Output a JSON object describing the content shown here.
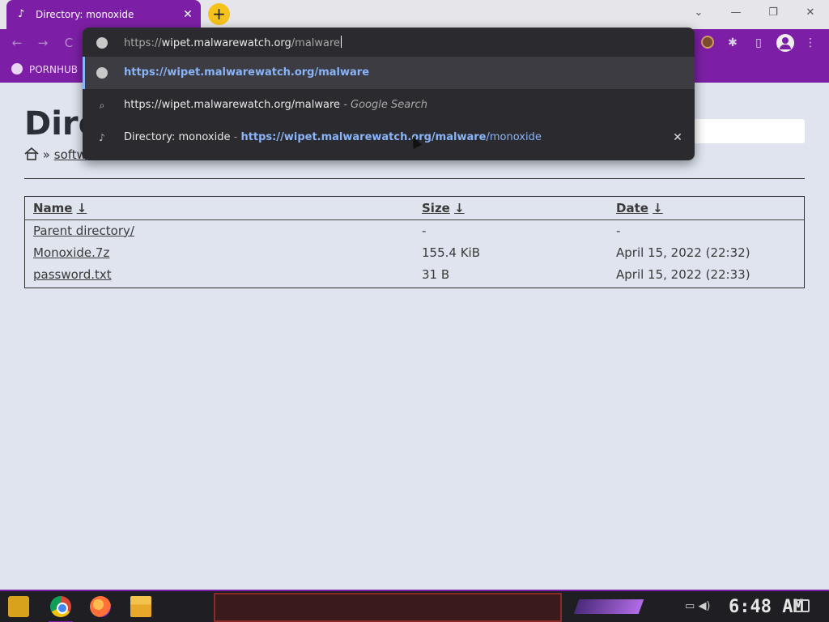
{
  "browser": {
    "tab_title": "Directory: monoxide",
    "tab_close": "✕",
    "new_tab": "+",
    "window_controls": {
      "minimize": "—",
      "maximize": "❐",
      "close": "✕",
      "tablist": "⌄"
    }
  },
  "toolbar": {
    "back": "←",
    "forward": "→",
    "reload": "C",
    "extensions_icon": "puzzle-icon",
    "sidebar_icon": "sidebar-icon",
    "menu": "⋮"
  },
  "bookmarks": [
    {
      "label": "PORNHUB"
    }
  ],
  "omnibox": {
    "input_prefix": "https://",
    "input_host": "wipet.malwarewatch.org",
    "input_path": "/malware",
    "suggestions": [
      {
        "type": "url",
        "icon": "globe-icon",
        "url": "https://wipet.malwarewatch.org/malware",
        "selected": true
      },
      {
        "type": "search",
        "icon": "search-icon",
        "query": "https://wipet.malwarewatch.org/malware",
        "suffix": "- Google Search"
      },
      {
        "type": "history",
        "icon": "page-favicon-icon",
        "title": "Directory: monoxide",
        "dash": "-",
        "url_match": "https://wipet.malwarewatch.org/malware",
        "url_rest": "/monoxide",
        "remove": "✕"
      }
    ]
  },
  "page": {
    "heading": "Dire",
    "breadcrumb_sep": "»",
    "breadcrumb_link": "softw",
    "table": {
      "headers": [
        {
          "label": "Name",
          "arrow": "↓"
        },
        {
          "label": "Size",
          "arrow": "↓"
        },
        {
          "label": "Date",
          "arrow": "↓"
        }
      ],
      "rows": [
        {
          "name": "Parent directory/",
          "size": "-",
          "date": "-"
        },
        {
          "name": "Monoxide.7z",
          "size": "155.4 KiB",
          "date": "April 15, 2022 (22:32)"
        },
        {
          "name": "password.txt",
          "size": "31 B",
          "date": "April 15, 2022 (22:33)"
        }
      ]
    }
  },
  "taskbar": {
    "clock": "6:48 AM",
    "apps": [
      "start-icon",
      "chrome-icon",
      "firefox-icon",
      "file-explorer-icon"
    ]
  }
}
